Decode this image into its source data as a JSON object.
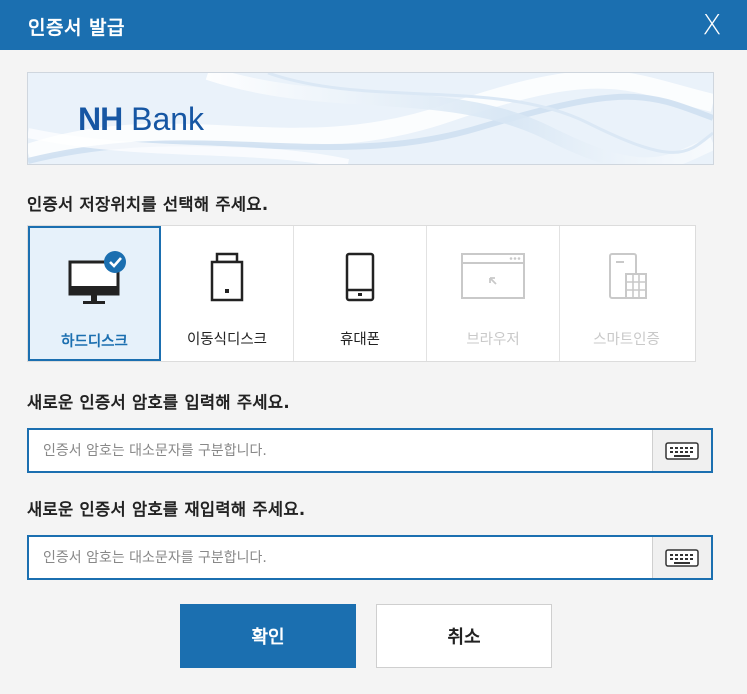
{
  "dialog": {
    "title": "인증서 발급",
    "close_glyph": "X"
  },
  "banner": {
    "logo_bold": "NH",
    "logo_rest": "Bank"
  },
  "storage": {
    "prompt": "인증서 저장위치를 선택해 주세요.",
    "options": [
      {
        "label": "하드디스크",
        "icon": "monitor-icon",
        "state": "selected"
      },
      {
        "label": "이동식디스크",
        "icon": "usb-drive-icon",
        "state": "enabled"
      },
      {
        "label": "휴대폰",
        "icon": "phone-icon",
        "state": "enabled"
      },
      {
        "label": "브라우저",
        "icon": "browser-icon",
        "state": "disabled"
      },
      {
        "label": "스마트인증",
        "icon": "smart-auth-icon",
        "state": "disabled"
      }
    ]
  },
  "password": {
    "prompt": "새로운 인증서 암호를 입력해 주세요.",
    "placeholder": "인증서 암호는 대소문자를 구분합니다.",
    "value": ""
  },
  "password_confirm": {
    "prompt": "새로운 인증서 암호를 재입력해 주세요.",
    "placeholder": "인증서 암호는 대소문자를 구분합니다.",
    "value": ""
  },
  "buttons": {
    "ok": "확인",
    "cancel": "취소"
  },
  "colors": {
    "accent": "#1b6fb0",
    "disabled": "#c9c9c9",
    "background": "#f4f4f4"
  }
}
